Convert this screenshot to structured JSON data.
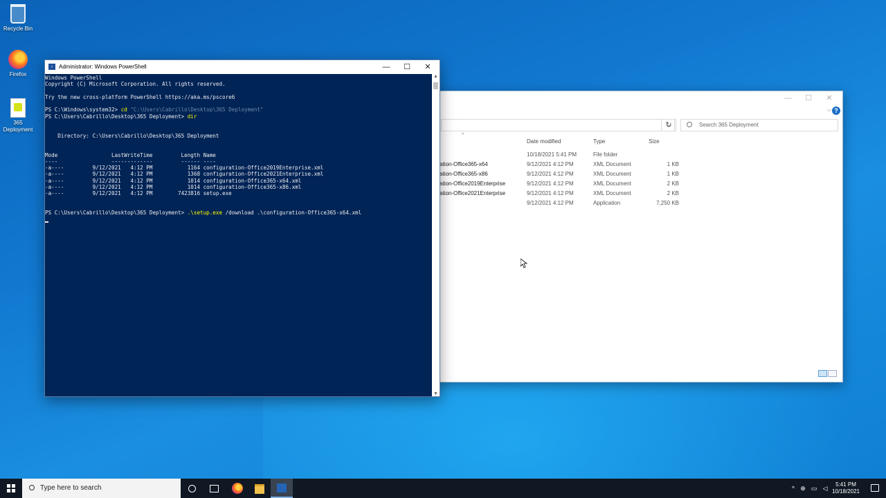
{
  "desktop": {
    "icons": [
      {
        "label": "Recycle Bin"
      },
      {
        "label": "Firefox"
      },
      {
        "label": "365 Deployment"
      }
    ]
  },
  "explorer": {
    "search_placeholder": "Search 365 Deployment",
    "columns": {
      "date": "Date modified",
      "type": "Type",
      "size": "Size"
    },
    "rows": [
      {
        "name": "",
        "date": "10/18/2021 5:41 PM",
        "type": "File folder",
        "size": ""
      },
      {
        "name": "ation-Office365-x64",
        "date": "9/12/2021 4:12 PM",
        "type": "XML Document",
        "size": "1 KB"
      },
      {
        "name": "ation-Office365-x86",
        "date": "9/12/2021 4:12 PM",
        "type": "XML Document",
        "size": "1 KB"
      },
      {
        "name": "ation-Office2019Enterprise",
        "date": "9/12/2021 4:12 PM",
        "type": "XML Document",
        "size": "2 KB"
      },
      {
        "name": "ation-Office2021Enterprise",
        "date": "9/12/2021 4:12 PM",
        "type": "XML Document",
        "size": "2 KB"
      },
      {
        "name": "",
        "date": "9/12/2021 4:12 PM",
        "type": "Application",
        "size": "7,250 KB"
      }
    ]
  },
  "powershell": {
    "title": "Administrator: Windows PowerShell",
    "lines": {
      "l1": "Windows PowerShell",
      "l2": "Copyright (C) Microsoft Corporation. All rights reserved.",
      "l3": "Try the new cross-platform PowerShell https://aka.ms/pscore6",
      "l4_prompt": "PS C:\\Windows\\system32> ",
      "l4_cmd": "cd",
      "l4_arg": " \"C:\\Users\\Cabrillo\\Desktop\\365 Deployment\"",
      "l5_prompt": "PS C:\\Users\\Cabrillo\\Desktop\\365 Deployment> ",
      "l5_cmd": "dir",
      "dir_header": "    Directory: C:\\Users\\Cabrillo\\Desktop\\365 Deployment",
      "col_header": "Mode                 LastWriteTime         Length Name",
      "col_rule": "----                 -------------         ------ ----",
      "f1": "-a----         9/12/2021   4:12 PM           1164 configuration-Office2019Enterprise.xml",
      "f2": "-a----         9/12/2021   4:12 PM           1368 configuration-Office2021Enterprise.xml",
      "f3": "-a----         9/12/2021   4:12 PM           1014 configuration-Office365-x64.xml",
      "f4": "-a----         9/12/2021   4:12 PM           1014 configuration-Office365-x86.xml",
      "f5": "-a----         9/12/2021   4:12 PM        7423816 setup.exe",
      "l6_prompt": "PS C:\\Users\\Cabrillo\\Desktop\\365 Deployment> ",
      "l6_cmd": ".\\setup.exe",
      "l6_arg": " /download .\\configuration-Office365-x64.xml"
    }
  },
  "taskbar": {
    "search_placeholder": "Type here to search",
    "clock_time": "5:41 PM",
    "clock_date": "10/18/2021"
  }
}
